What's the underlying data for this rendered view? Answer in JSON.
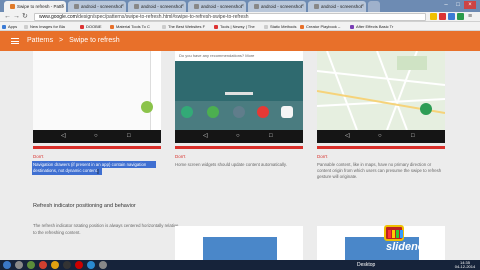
{
  "browser": {
    "tabs": [
      {
        "label": "Swipe to refresh - Patte"
      },
      {
        "label": "android - screenshot"
      },
      {
        "label": "android - screenshot"
      },
      {
        "label": "android - screenshot"
      },
      {
        "label": "android - screenshot"
      },
      {
        "label": "android - screenshot"
      }
    ],
    "url_domain": "www.google.com",
    "url_path": "/design/spec/patterns/swipe-to-refresh.html#swipe-to-refresh-swipe-to-refresh",
    "bookmarks": [
      "Apps",
      "New Images for Bla",
      "DOOBIE",
      "Material Tools To C",
      "The Best Websites F",
      "Tools | Newsy | The",
      "Static Methods",
      "Creator Playbook –",
      "After Effects Basic Tr"
    ]
  },
  "header": {
    "section": "Patterns",
    "separator": ">",
    "page": "Swipe to refresh"
  },
  "card_top": {
    "text": "Do you have any recommendations? More"
  },
  "examples": [
    {
      "label": "Don't",
      "caption": "Navigation drawers (if present in an app) contain navigation destinations, not dynamic content."
    },
    {
      "label": "Don't",
      "caption": "Home screen widgets should update content automatically."
    },
    {
      "label": "Don't",
      "caption": "Pannable content, like in maps, have no primary direction or content origin from which users can presume the swipe to refresh gesture will originate."
    }
  ],
  "section2": {
    "heading": "Refresh indicator positioning and behavior",
    "body": "The refresh indicator rotating position is always centered horizontally relative to the refreshing content."
  },
  "taskbar": {
    "desktop": "Desktop",
    "time": "14:35",
    "date": "04-12-2014"
  },
  "watermark": "slidenerd",
  "colors": {
    "header": "#e8702a",
    "dont": "#d9302b",
    "selection": "#3f6fd1",
    "taskbar": "#16233a"
  }
}
